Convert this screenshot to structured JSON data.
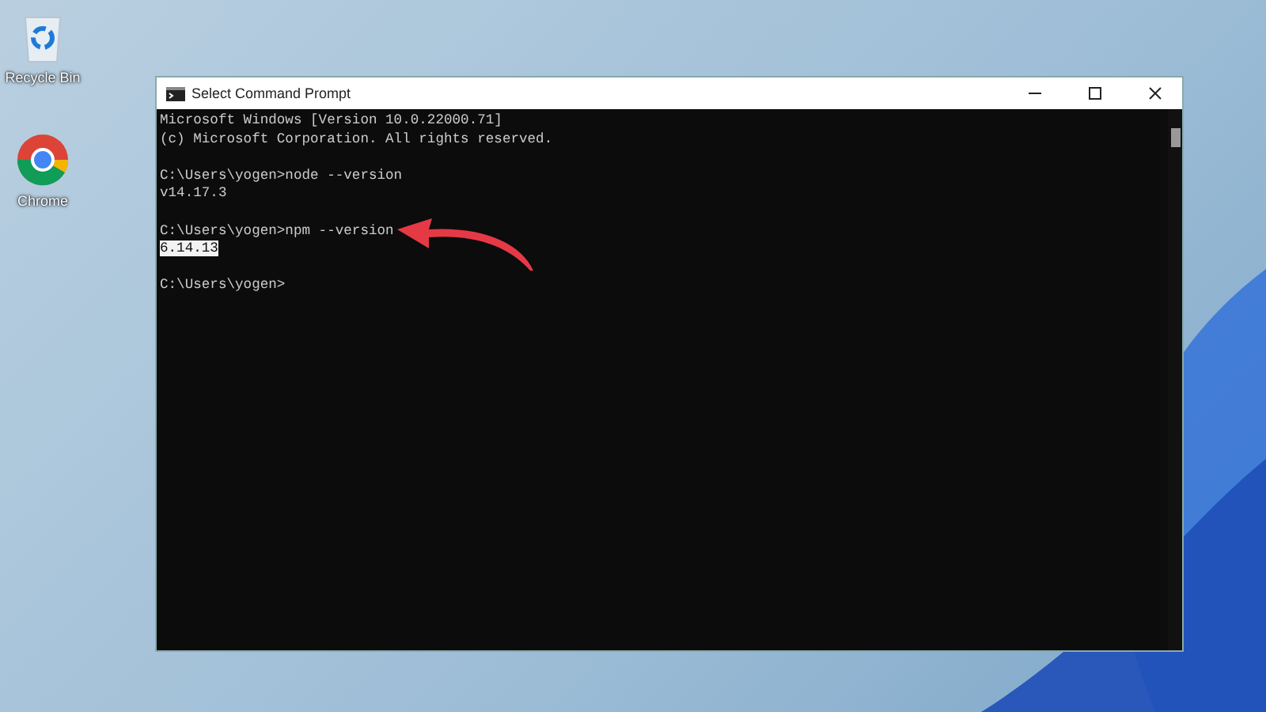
{
  "desktop_icons": [
    {
      "label": "Recycle Bin",
      "kind": "bin"
    },
    {
      "label": "Chrome",
      "kind": "chrome"
    }
  ],
  "window": {
    "title": "Select Command Prompt"
  },
  "console": {
    "blocks": [
      [
        {
          "text": "Microsoft Windows [Version 10.0.22000.71]",
          "selected": false
        },
        {
          "text": "(c) Microsoft Corporation. All rights reserved.",
          "selected": false
        }
      ],
      [
        {
          "text": "C:\\Users\\yogen>node --version",
          "selected": false
        },
        {
          "text": "v14.17.3",
          "selected": false
        }
      ],
      [
        {
          "text": "C:\\Users\\yogen>npm --version",
          "selected": false
        },
        {
          "text": "6.14.13",
          "selected": true
        }
      ],
      [
        {
          "text": "C:\\Users\\yogen>",
          "selected": false
        }
      ]
    ]
  }
}
